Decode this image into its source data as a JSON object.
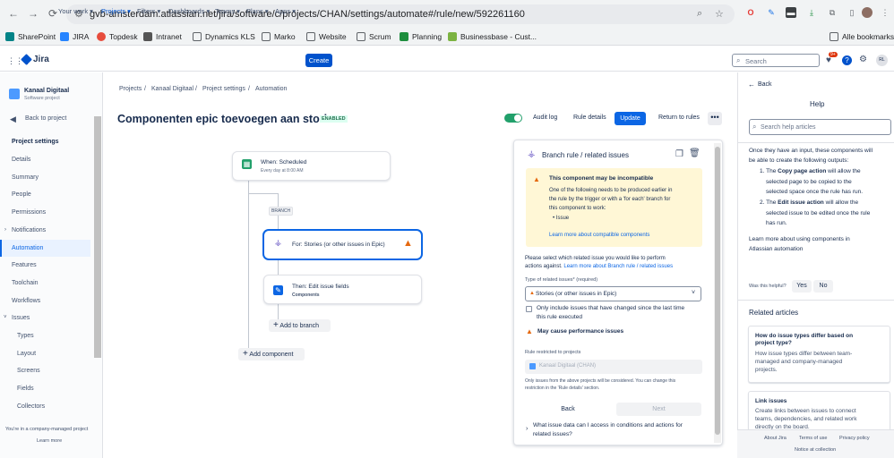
{
  "browser": {
    "url": "gvb-amsterdam.atlassian.net/jira/software/c/projects/CHAN/settings/automate#/rule/new/592261160",
    "bookmarks": [
      {
        "label": "SharePoint",
        "color": "#038387"
      },
      {
        "label": "JIRA",
        "color": "#2684ff"
      },
      {
        "label": "Topdesk",
        "color": "#e74c3c"
      },
      {
        "label": "Intranet",
        "color": "#555555"
      },
      {
        "label": "Dynamics KLS",
        "color": "#5f6368"
      },
      {
        "label": "Marko",
        "color": "#5f6368"
      },
      {
        "label": "Website",
        "color": "#5f6368"
      },
      {
        "label": "Scrum",
        "color": "#5f6368"
      },
      {
        "label": "Planning",
        "color": "#1e8e3e"
      },
      {
        "label": "Businessbase - Cust...",
        "color": "#7cb342"
      }
    ],
    "all_bookmarks": "Alle bookmarks"
  },
  "topnav": {
    "logo": "Jira",
    "items": [
      "Your work",
      "Projects",
      "Filters",
      "Dashboards",
      "Teams",
      "Plans",
      "Apps"
    ],
    "create": "Create",
    "search_placeholder": "Search",
    "notif_count": "9+",
    "avatar": "RL"
  },
  "sidebar": {
    "project_name": "Kanaal Digitaal",
    "project_type": "Software project",
    "back": "Back to project",
    "heading": "Project settings",
    "items": [
      "Details",
      "Summary",
      "People",
      "Permissions",
      "Notifications",
      "Automation",
      "Features",
      "Toolchain",
      "Workflows",
      "Issues"
    ],
    "sub_items": [
      "Types",
      "Layout",
      "Screens",
      "Fields",
      "Collectors"
    ],
    "footer": "You're in a company-managed project",
    "learn_more": "Learn more"
  },
  "breadcrumbs": [
    "Projects",
    "Kanaal Digitaal",
    "Project settings",
    "Automation"
  ],
  "rule": {
    "title": "Componenten epic toevoegen aan stories",
    "status": "ENABLED",
    "audit_log": "Audit log",
    "rule_details": "Rule details",
    "update": "Update",
    "return": "Return to rules"
  },
  "flow": {
    "trigger_title": "When: Scheduled",
    "trigger_sub": "Every day at 8:00 AM",
    "branch_tag": "BRANCH",
    "branch_title": "For: Stories (or other issues in Epic)",
    "action_title": "Then: Edit issue fields",
    "action_sub": "Components",
    "add_to_branch": "Add to branch",
    "add_component": "Add component"
  },
  "panel": {
    "title": "Branch rule / related issues",
    "warn_title": "This component may be incompatible",
    "warn_lines": [
      "One of the following needs to be produced earlier in",
      "the rule by the trigger or with a 'for each' branch for",
      "this component to work:"
    ],
    "warn_item": "Issue",
    "warn_link": "Learn more about compatible components",
    "instruction_1": "Please select which related issue you would like to perform",
    "instruction_2": "actions against.",
    "instruction_link": "Learn more about Branch rule / related issues",
    "type_label": "Type of related issues*",
    "required": "(required)",
    "type_value": "Stories (or other issues in Epic)",
    "checkbox_1": "Only include issues that have changed since the last time",
    "checkbox_2": "this rule executed",
    "perf_warning": "May cause performance issues",
    "restrict_label": "Rule restricted to projects",
    "project_chip": "Kanaal Digitaal (CHAN)",
    "note_1": "Only issues from the above projects will be considered. You can change this",
    "note_2": "restriction in the 'Rule details' section.",
    "back": "Back",
    "next": "Next",
    "faq_1": "What issue data can I access in conditions and actions for",
    "faq_2": "related issues?"
  },
  "help": {
    "back": "Back",
    "title": "Help",
    "search_placeholder": "Search help articles",
    "intro_1": "Once they have an input, these components will",
    "intro_2": "be able to create the following outputs:",
    "li1_pre": "The",
    "li1_bold": "Copy page action",
    "li1_post": "will allow the",
    "li1_2": "selected page to be copied to the",
    "li1_3": "selected space once the rule has run.",
    "li2_pre": "The",
    "li2_bold": "Edit issue action",
    "li2_post": "will allow the",
    "li2_2": "selected issue to be edited once the rule",
    "li2_3": "has run.",
    "link_1": "Learn more about using components in",
    "link_2": "Atlassian automation",
    "helpful": "Was this helpful?",
    "yes": "Yes",
    "no": "No",
    "related": "Related articles",
    "art1_title_1": "How do issue types differ based on",
    "art1_title_2": "project type?",
    "art1_desc_1": "How issue types differ between team-",
    "art1_desc_2": "managed and company-managed",
    "art1_desc_3": "projects.",
    "art2_title": "Link issues",
    "art2_desc_1": "Create links between issues to connect",
    "art2_desc_2": "teams, dependencies, and related work",
    "art2_desc_3": "directly on the board.",
    "footer": [
      "About Jira",
      "Terms of use",
      "Privacy policy"
    ],
    "footer_notice": "Notice at collection"
  }
}
